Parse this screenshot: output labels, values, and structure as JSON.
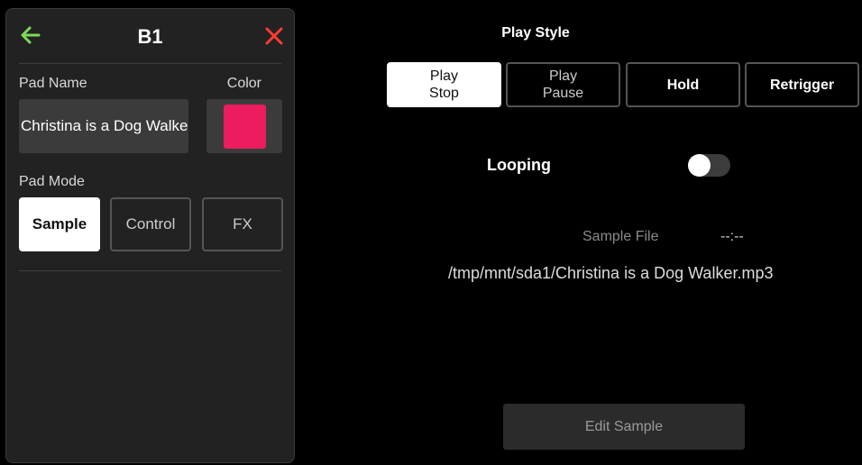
{
  "pad_panel": {
    "title": "B1",
    "pad_name_label": "Pad Name",
    "color_label": "Color",
    "pad_name_value": "Christina is a Dog Walker",
    "pad_color": "#ec1c5e",
    "pad_mode_label": "Pad Mode",
    "modes": [
      {
        "label": "Sample",
        "active": true
      },
      {
        "label": "Control",
        "active": false
      },
      {
        "label": "FX",
        "active": false
      }
    ],
    "back_icon": "arrow-left-icon",
    "back_icon_color": "#7ed957",
    "close_icon": "close-icon",
    "close_icon_color": "#ff3b30"
  },
  "play_style": {
    "title": "Play Style",
    "options": [
      {
        "line1": "Play",
        "line2": "Stop",
        "active": true
      },
      {
        "line1": "Play",
        "line2": "Pause",
        "active": false
      },
      {
        "line1": "Hold",
        "line2": "",
        "active": false
      },
      {
        "line1": "Retrigger",
        "line2": "",
        "active": false
      }
    ]
  },
  "looping": {
    "label": "Looping",
    "enabled": false
  },
  "sample": {
    "file_label": "Sample File",
    "time": "--:--",
    "path": "/tmp/mnt/sda1/Christina is a Dog Walker.mp3"
  },
  "edit_button_label": "Edit Sample"
}
